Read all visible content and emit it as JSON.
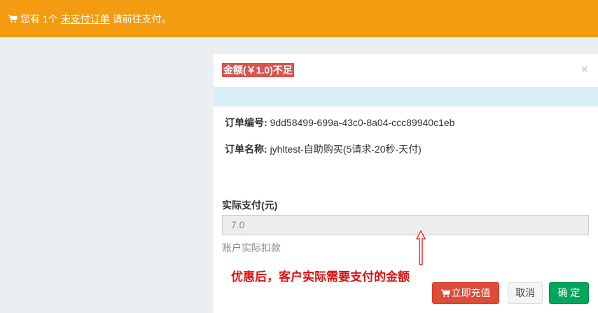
{
  "alert": {
    "prefix": "您有 1个",
    "link": "未支付订单",
    "suffix": "请前往支付。"
  },
  "modal": {
    "title": "金额(￥1.0)不足",
    "close": "×",
    "order_no_label": "订单编号:",
    "order_no_value": "9dd58499-699a-43c0-8a04-ccc89940c1eb",
    "order_name_label": "订单名称:",
    "order_name_value": "jyhltest-自助购买(5请求-20秒-天付)",
    "pay_label": "实际支付(元)",
    "pay_value": "7.0",
    "help_text": "账户实际扣款",
    "buttons": {
      "recharge": "立即充值",
      "cancel": "取消",
      "ok": "确 定"
    }
  },
  "annotation": {
    "text": "优惠后，客户实际需要支付的金额"
  },
  "colors": {
    "alert_bg": "#f39c12",
    "danger": "#dd4b39",
    "success": "#00a65a",
    "info_strip": "#d9edf7",
    "annotation": "#e01010"
  }
}
